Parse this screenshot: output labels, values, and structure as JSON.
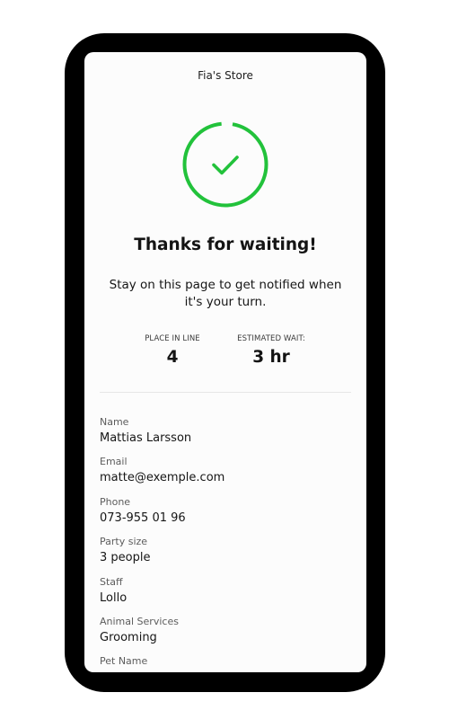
{
  "store": {
    "name": "Fia's Store"
  },
  "status": {
    "icon": "check-circle-icon",
    "color": "#22c23b",
    "title": "Thanks for waiting!",
    "message": "Stay on this page to get notified when it's your turn."
  },
  "queue": {
    "place_label": "PLACE IN LINE",
    "place_value": "4",
    "wait_label": "ESTIMATED WAIT:",
    "wait_value": "3 hr"
  },
  "details": [
    {
      "label": "Name",
      "value": "Mattias Larsson"
    },
    {
      "label": "Email",
      "value": "matte@exemple.com"
    },
    {
      "label": "Phone",
      "value": "073-955 01 96"
    },
    {
      "label": "Party size",
      "value": "3 people"
    },
    {
      "label": "Staff",
      "value": "Lollo"
    },
    {
      "label": "Animal Services",
      "value": "Grooming"
    },
    {
      "label": "Pet Name",
      "value": ""
    }
  ]
}
